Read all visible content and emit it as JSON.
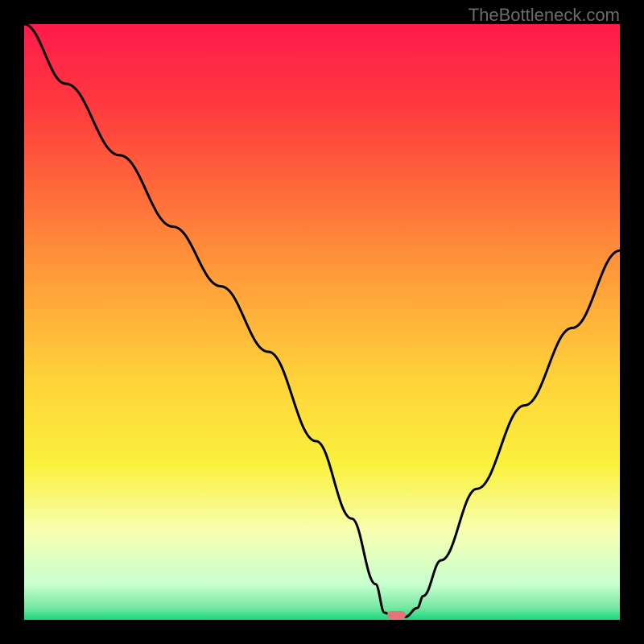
{
  "watermark": "TheBottleneck.com",
  "chart_data": {
    "type": "line",
    "title": "",
    "xlabel": "",
    "ylabel": "",
    "xlim": [
      0,
      100
    ],
    "ylim": [
      0,
      100
    ],
    "grid": false,
    "series": [
      {
        "name": "bottleneck-curve",
        "x": [
          0,
          7,
          16,
          25,
          33,
          41,
          49,
          55,
          59,
          60.5,
          62,
          64,
          66,
          67,
          70,
          76,
          84,
          92,
          100
        ],
        "y": [
          100,
          90,
          78,
          66,
          56,
          45,
          30,
          17,
          6,
          1.2,
          0.5,
          0.5,
          2,
          4,
          10,
          22,
          36,
          49,
          62
        ]
      }
    ],
    "background_gradient_stops": [
      {
        "offset": 0,
        "color": "#ff1a4c"
      },
      {
        "offset": 14,
        "color": "#ff3a3e"
      },
      {
        "offset": 28,
        "color": "#ff6a3a"
      },
      {
        "offset": 45,
        "color": "#ffa53a"
      },
      {
        "offset": 60,
        "color": "#ffd33a"
      },
      {
        "offset": 74,
        "color": "#faf13d"
      },
      {
        "offset": 85,
        "color": "#f8ffb0"
      },
      {
        "offset": 94,
        "color": "#c8ffcf"
      },
      {
        "offset": 98,
        "color": "#74e8a1"
      },
      {
        "offset": 100,
        "color": "#17d67c"
      }
    ],
    "marker": {
      "name": "optimal-point",
      "x_pct": 62.5,
      "y_pct": 99.2,
      "width_pct": 3.2,
      "height_pct": 1.4,
      "color": "#e8717a"
    }
  },
  "colors": {
    "frame": "#000000",
    "curve": "#000000",
    "watermark": "#6b6b6b"
  }
}
